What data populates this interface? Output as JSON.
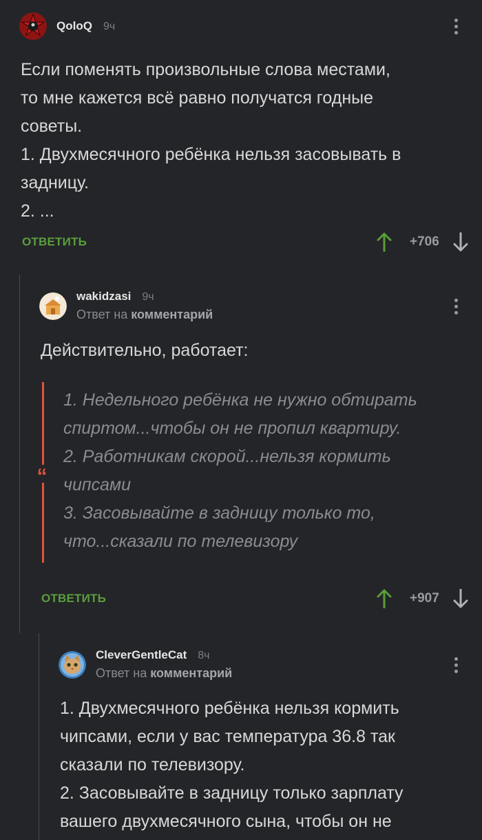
{
  "comments": [
    {
      "username": "QoloQ",
      "time": "9ч",
      "body": [
        "Если поменять произвольные слова местами,",
        "то мне кажется всё равно получатся годные",
        "советы.",
        "1. Двухмесячного ребёнка нельзя засовывать в",
        "задницу.",
        "2. ..."
      ],
      "reply_label": "ОТВЕТИТЬ",
      "rating": "+706"
    },
    {
      "username": "wakidzasi",
      "time": "9ч",
      "reply_to_prefix": "Ответ на",
      "reply_to_link": "комментарий",
      "body": [
        "Действительно, работает:"
      ],
      "quote": [
        "1. Недельного ребёнка не нужно обтирать",
        "спиртом...чтобы он не пропил квартиру.",
        "2. Работникам скорой...нельзя кормить",
        "чипсами",
        "3. Засовывайте в задницу только то,",
        "что...сказали по телевизору"
      ],
      "quote_mark": "“",
      "reply_label": "ОТВЕТИТЬ",
      "rating": "+907"
    },
    {
      "username": "CleverGentleCat",
      "time": "8ч",
      "reply_to_prefix": "Ответ на",
      "reply_to_link": "комментарий",
      "body": [
        "1. Двухмесячного ребёнка нельзя кормить",
        "чипсами, если у вас температура 36.8 так",
        "сказали по телевизору.",
        "2. Засовывайте в задницу только зарплату",
        "вашего двухмесячного сына, чтобы он не"
      ]
    }
  ],
  "icons": {
    "more": "more-vertical-icon",
    "upvote": "arrow-up-icon",
    "downvote": "arrow-down-icon"
  },
  "colors": {
    "background": "#242528",
    "accent_green": "#5a9e3c",
    "quote_bar": "#e3533a"
  }
}
